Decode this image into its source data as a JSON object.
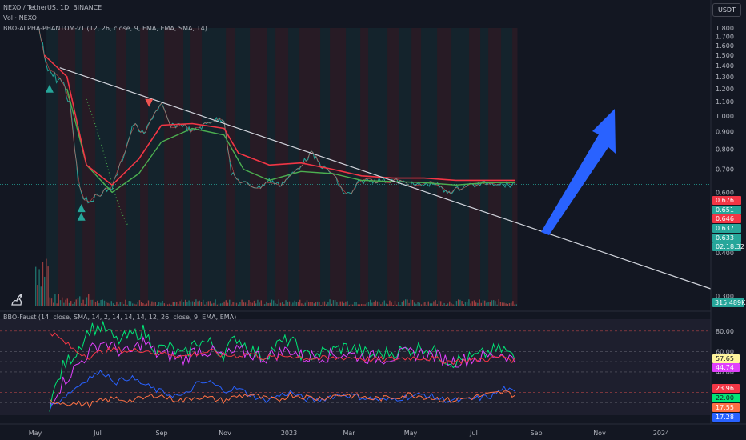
{
  "header": {
    "symbol_line": "NEXO / TetherUS, 1D, BINANCE",
    "volume_line": "Vol · NEXO",
    "indicator_line": "BBO-ALPHA-PHANTOM-v1 (12, 26, close, 9, EMA, EMA, SMA, 14)",
    "oscillator_line": "BBO-Faust (14, close, SMA, 14, 2, 14, 14, 14, 12, 26, close, 9, EMA, EMA)"
  },
  "currency_button": "USDT",
  "colors": {
    "background": "#131722",
    "up": "#26a69a",
    "down": "#ef5350",
    "arrow": "#2962ff",
    "trendline": "#d1d4dc",
    "ema_red": "#f23645",
    "ema_green": "#4caf50",
    "osc_green": "#00e676",
    "osc_pink": "#e040fb",
    "osc_blue": "#2962ff",
    "osc_orange": "#ff7043"
  },
  "chart_data": [
    {
      "type": "line",
      "x_ticks": [
        "May",
        "Jul",
        "Sep",
        "Nov",
        "2023",
        "Mar",
        "May",
        "Jul",
        "Sep",
        "Nov",
        "2024"
      ],
      "y_ticks": [
        "1.800",
        "1.700",
        "1.600",
        "1.500",
        "1.400",
        "1.300",
        "1.200",
        "1.100",
        "1.000",
        "0.900",
        "0.800",
        "0.700",
        "0.600",
        "0.500",
        "0.400",
        "0.300"
      ],
      "y_scale": "log",
      "ylim": [
        0.3,
        1.8
      ],
      "grid": false,
      "price": {
        "dates": [
          "2022-05-05",
          "2022-05-10",
          "2022-05-15",
          "2022-05-20",
          "2022-05-27",
          "2022-06-05",
          "2022-06-12",
          "2022-06-18",
          "2022-06-25",
          "2022-07-05",
          "2022-07-15",
          "2022-07-25",
          "2022-08-05",
          "2022-08-15",
          "2022-08-25",
          "2022-09-01",
          "2022-09-10",
          "2022-09-20",
          "2022-10-01",
          "2022-10-10",
          "2022-10-20",
          "2022-11-01",
          "2022-11-08",
          "2022-11-15",
          "2022-11-25",
          "2022-12-05",
          "2022-12-15",
          "2022-12-25",
          "2023-01-05",
          "2023-01-15",
          "2023-01-25",
          "2023-02-05",
          "2023-02-15",
          "2023-02-25",
          "2023-03-05",
          "2023-03-12",
          "2023-03-20",
          "2023-04-01",
          "2023-04-15",
          "2023-04-25",
          "2023-05-05",
          "2023-05-15",
          "2023-05-25",
          "2023-06-05",
          "2023-06-15",
          "2023-06-25",
          "2023-07-05",
          "2023-07-15",
          "2023-07-25",
          "2023-08-05",
          "2023-08-12"
        ],
        "values": [
          1.75,
          1.5,
          1.35,
          1.3,
          1.25,
          1.05,
          0.64,
          0.58,
          0.57,
          0.6,
          0.62,
          0.75,
          0.95,
          0.88,
          1.02,
          1.08,
          0.93,
          0.95,
          0.9,
          0.93,
          0.97,
          0.98,
          0.68,
          0.65,
          0.63,
          0.62,
          0.65,
          0.63,
          0.67,
          0.72,
          0.78,
          0.71,
          0.68,
          0.6,
          0.59,
          0.64,
          0.65,
          0.65,
          0.65,
          0.64,
          0.63,
          0.63,
          0.64,
          0.6,
          0.61,
          0.63,
          0.63,
          0.64,
          0.64,
          0.63,
          0.633
        ]
      },
      "ema_red": {
        "dates": [
          "2022-05-10",
          "2022-06-01",
          "2022-06-20",
          "2022-07-15",
          "2022-08-10",
          "2022-09-01",
          "2022-10-01",
          "2022-11-01",
          "2022-11-15",
          "2022-12-15",
          "2023-01-15",
          "2023-02-15",
          "2023-03-15",
          "2023-04-15",
          "2023-05-15",
          "2023-06-15",
          "2023-07-15",
          "2023-08-12"
        ],
        "values": [
          1.5,
          1.3,
          0.72,
          0.63,
          0.75,
          0.94,
          0.95,
          0.92,
          0.78,
          0.72,
          0.73,
          0.7,
          0.67,
          0.66,
          0.66,
          0.65,
          0.65,
          0.65
        ]
      },
      "ema_green": {
        "dates": [
          "2022-06-01",
          "2022-06-20",
          "2022-07-15",
          "2022-08-10",
          "2022-09-01",
          "2022-10-01",
          "2022-11-01",
          "2022-11-20",
          "2022-12-15",
          "2023-01-15",
          "2023-02-15",
          "2023-03-15",
          "2023-04-15",
          "2023-05-15",
          "2023-06-15",
          "2023-07-15",
          "2023-08-12"
        ],
        "values": [
          1.2,
          0.72,
          0.6,
          0.68,
          0.84,
          0.92,
          0.88,
          0.7,
          0.65,
          0.69,
          0.68,
          0.65,
          0.645,
          0.64,
          0.63,
          0.64,
          0.64
        ]
      },
      "trendline": {
        "start": {
          "date": "2022-05-25",
          "value": 1.38
        },
        "end": {
          "date": "2024-03-10",
          "value": 0.3
        }
      },
      "signals": [
        {
          "date": "2022-05-15",
          "value": 1.2,
          "kind": "buy"
        },
        {
          "date": "2022-06-15",
          "value": 0.54,
          "kind": "buy"
        },
        {
          "date": "2022-06-15",
          "value": 0.51,
          "kind": "buy"
        },
        {
          "date": "2022-08-20",
          "value": 1.09,
          "kind": "sell"
        }
      ],
      "price_labels": [
        {
          "text": "0.676",
          "color": "#f23645"
        },
        {
          "text": "0.651",
          "color": "#26a69a"
        },
        {
          "text": "0.646",
          "color": "#f23645"
        },
        {
          "text": "0.637",
          "color": "#26a69a"
        },
        {
          "text": "0.633",
          "color": "#26a69a"
        },
        {
          "text": "02:18:32",
          "color": "#26a69a"
        }
      ],
      "volume_label": {
        "text": "315.489K",
        "color": "#26a69a"
      }
    },
    {
      "type": "line",
      "y_ticks": [
        "80.00",
        "60.00",
        "40.00"
      ],
      "ylim": [
        0,
        90
      ],
      "reference_lines": [
        80,
        60,
        50,
        40,
        20,
        10
      ],
      "series": [
        {
          "color": "#00e676",
          "values": [
            8,
            45,
            60,
            82,
            84,
            70,
            75,
            80,
            62,
            64,
            55,
            70,
            68,
            58,
            74,
            62,
            55,
            66,
            72,
            55,
            58,
            60,
            64,
            62,
            56,
            58,
            60,
            62,
            65,
            58,
            50,
            52,
            55,
            60,
            62,
            50
          ]
        },
        {
          "color": "#e040fb",
          "values": [
            10,
            30,
            45,
            60,
            70,
            62,
            58,
            70,
            58,
            56,
            52,
            62,
            60,
            55,
            60,
            58,
            54,
            58,
            62,
            54,
            56,
            56,
            58,
            56,
            54,
            54,
            56,
            58,
            58,
            55,
            50,
            52,
            54,
            56,
            58,
            48
          ]
        },
        {
          "color": "#f23645",
          "values": [
            80,
            70,
            60,
            55,
            60,
            62,
            60,
            62,
            58,
            58,
            55,
            58,
            60,
            56,
            56,
            58,
            54,
            54,
            56,
            54,
            53,
            53,
            54,
            54,
            52,
            52,
            53,
            54,
            54,
            52,
            50,
            51,
            52,
            53,
            55,
            50
          ]
        },
        {
          "color": "#2962ff",
          "values": [
            5,
            15,
            25,
            35,
            40,
            30,
            35,
            28,
            22,
            18,
            16,
            28,
            30,
            22,
            24,
            18,
            12,
            16,
            20,
            14,
            12,
            16,
            18,
            16,
            14,
            12,
            14,
            16,
            18,
            14,
            12,
            12,
            14,
            16,
            24,
            18
          ]
        },
        {
          "color": "#ff7043",
          "values": [
            12,
            10,
            9,
            8,
            12,
            14,
            12,
            14,
            18,
            14,
            12,
            16,
            14,
            12,
            16,
            18,
            14,
            12,
            18,
            16,
            14,
            16,
            18,
            16,
            14,
            14,
            16,
            18,
            16,
            14,
            12,
            14,
            16,
            18,
            20,
            17
          ]
        }
      ],
      "value_labels": [
        {
          "text": "57.65",
          "color": "#fff59d"
        },
        {
          "text": "44.74",
          "color": "#e040fb"
        },
        {
          "text": "23.96",
          "color": "#f23645"
        },
        {
          "text": "22.00",
          "color": "#00e676"
        },
        {
          "text": "17.55",
          "color": "#ff7043"
        },
        {
          "text": "17.28",
          "color": "#2962ff"
        }
      ]
    }
  ]
}
